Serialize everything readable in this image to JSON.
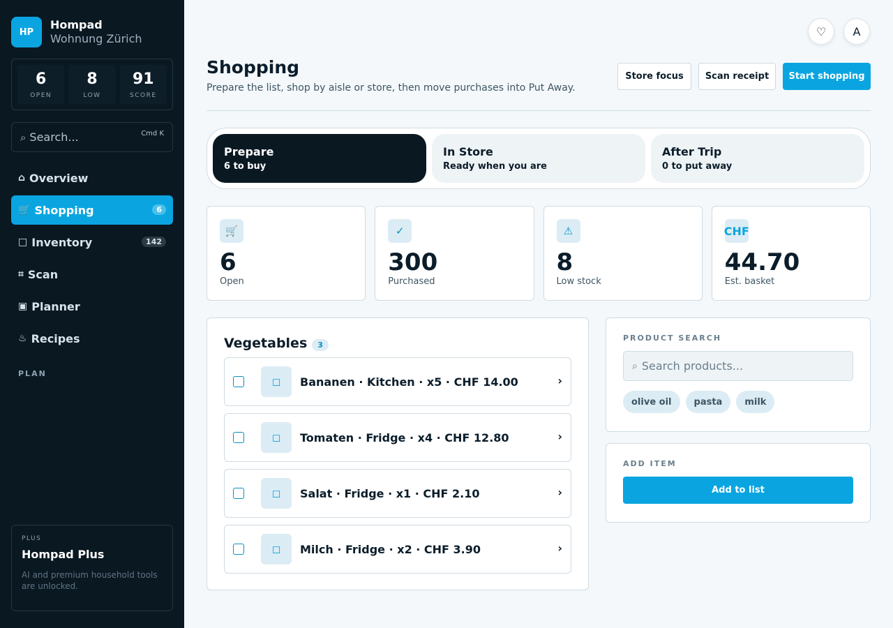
{
  "brand": {
    "logo": "HP",
    "name": "Hompad",
    "subtitle": "Wohnung Zürich"
  },
  "sidebar_stats": [
    {
      "value": "6",
      "label": "OPEN"
    },
    {
      "value": "8",
      "label": "LOW"
    },
    {
      "value": "91",
      "label": "SCORE"
    }
  ],
  "sidebar_search": {
    "icon": "⌕",
    "placeholder": "Search...",
    "shortcut": "Cmd K"
  },
  "nav": [
    {
      "icon": "⌂",
      "label": "Overview",
      "badge": ""
    },
    {
      "icon": "🛒",
      "label": "Shopping",
      "badge": "6"
    },
    {
      "icon": "□",
      "label": "Inventory",
      "badge": "142"
    },
    {
      "icon": "⌗",
      "label": "Scan",
      "badge": ""
    },
    {
      "icon": "▣",
      "label": "Planner",
      "badge": ""
    },
    {
      "icon": "♨",
      "label": "Recipes",
      "badge": ""
    }
  ],
  "nav_section": "PLAN",
  "plus": {
    "kicker": "PLUS",
    "title": "Hompad Plus",
    "description": "AI and premium household tools are unlocked."
  },
  "header_icons": {
    "favorite": "♡",
    "avatar": "A"
  },
  "page": {
    "title": "Shopping",
    "subtitle": "Prepare the list, shop by aisle or store, then move purchases into Put Away."
  },
  "actions": {
    "store_focus": "Store focus",
    "scan_receipt": "Scan receipt",
    "start_shopping": "Start shopping"
  },
  "phases": [
    {
      "title": "Prepare",
      "sub": "6 to buy"
    },
    {
      "title": "In Store",
      "sub": "Ready when you are"
    },
    {
      "title": "After Trip",
      "sub": "0 to put away"
    }
  ],
  "kpis": [
    {
      "icon": "🛒",
      "value": "6",
      "label": "Open"
    },
    {
      "icon": "✓",
      "value": "300",
      "label": "Purchased"
    },
    {
      "icon": "⚠",
      "value": "8",
      "label": "Low stock"
    },
    {
      "icon": "CHF",
      "value": "44.70",
      "label": "Est. basket"
    }
  ],
  "list": {
    "title": "Vegetables",
    "count": "3",
    "item_icon": "◻",
    "chevron": "›",
    "items": [
      "Bananen · Kitchen · x5 · CHF 14.00",
      "Tomaten · Fridge · x4 · CHF 12.80",
      "Salat · Fridge · x1 · CHF 2.10",
      "Milch · Fridge · x2 · CHF 3.90"
    ]
  },
  "product_search": {
    "kicker": "PRODUCT SEARCH",
    "icon": "⌕",
    "placeholder": "Search products...",
    "chips": [
      "olive oil",
      "pasta",
      "milk"
    ]
  },
  "add_item": {
    "kicker": "ADD ITEM",
    "button": "Add to list"
  },
  "colors": {
    "accent": "#0aa5e0",
    "sidebar_bg": "#0a1822",
    "page_bg": "#f4f8fb"
  }
}
